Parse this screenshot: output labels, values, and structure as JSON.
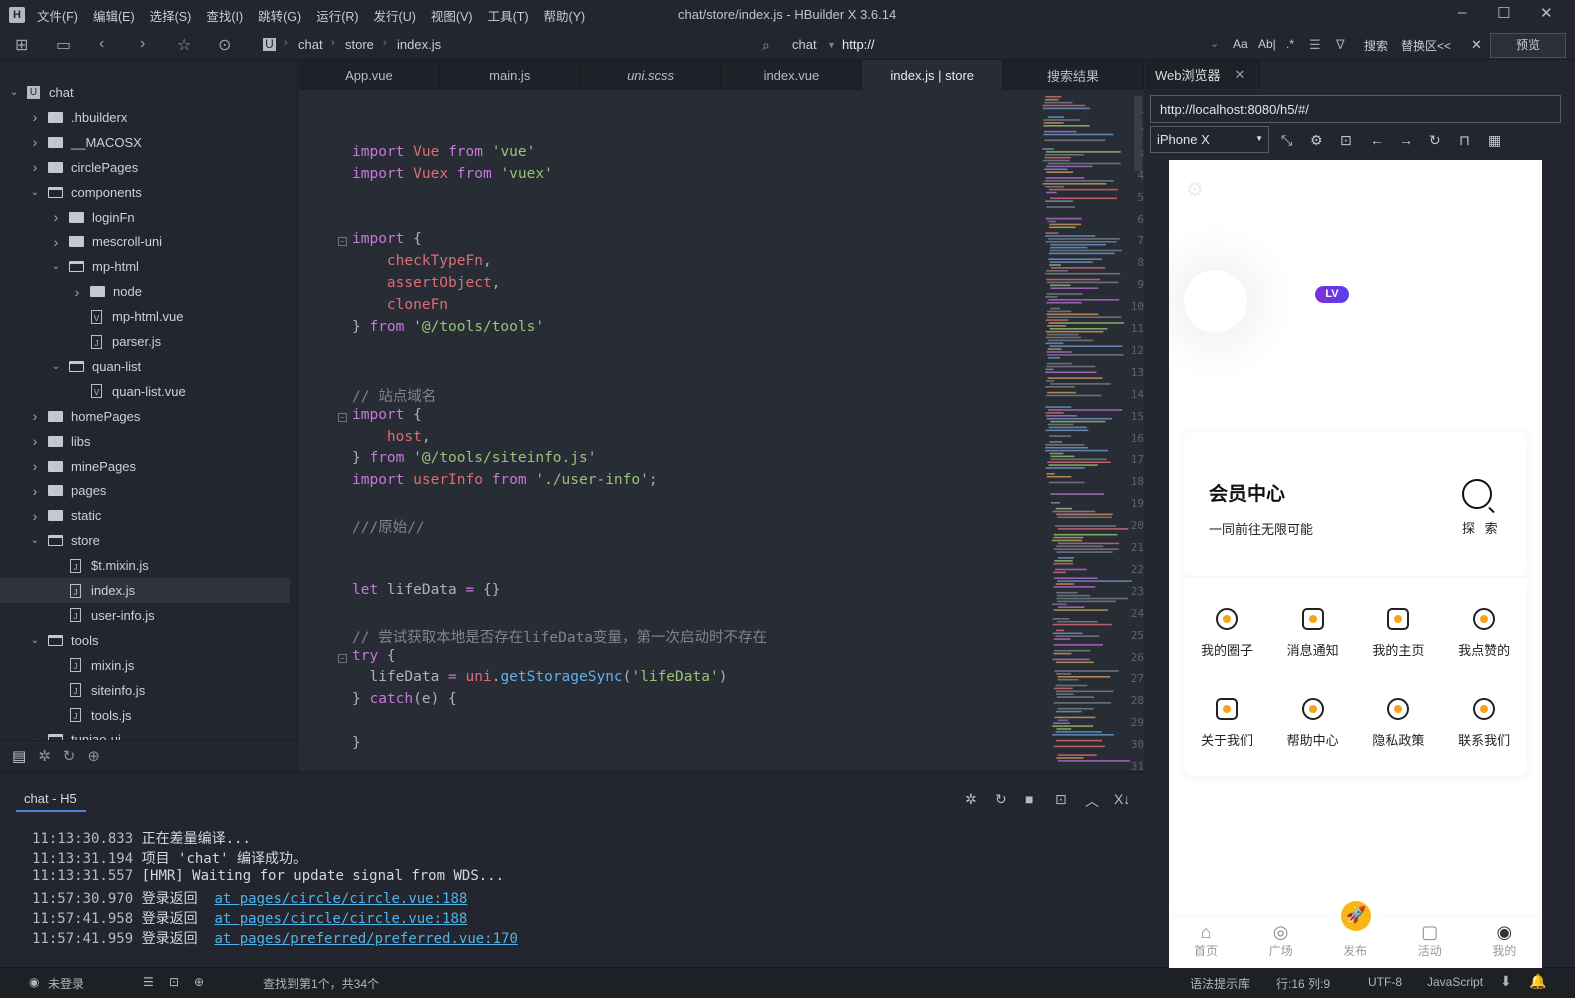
{
  "app": {
    "window_title": "chat/store/index.js - HBuilder X 3.6.14",
    "logo": "H",
    "menu": [
      "文件(F)",
      "编辑(E)",
      "选择(S)",
      "查找(I)",
      "跳转(G)",
      "运行(R)",
      "发行(U)",
      "视图(V)",
      "工具(T)",
      "帮助(Y)"
    ],
    "window_controls": {
      "minimize": "–",
      "maximize": "☐",
      "close": "✕"
    }
  },
  "toolbar": {
    "breadcrumb": [
      "chat",
      "store",
      "index.js"
    ],
    "project_select": "chat",
    "url_input": "http://",
    "search_label": "搜索",
    "replace_label": "替换区<<",
    "preview_label": "预览",
    "search_options": [
      "Aa",
      "Ab|",
      ".*"
    ]
  },
  "sidebar": {
    "tree": [
      {
        "label": "chat",
        "type": "project",
        "level": 0,
        "state": "open"
      },
      {
        "label": ".hbuilderx",
        "type": "folder",
        "level": 1,
        "state": "closed"
      },
      {
        "label": "__MACOSX",
        "type": "folder",
        "level": 1,
        "state": "closed"
      },
      {
        "label": "circlePages",
        "type": "folder",
        "level": 1,
        "state": "closed"
      },
      {
        "label": "components",
        "type": "folder",
        "level": 1,
        "state": "open"
      },
      {
        "label": "loginFn",
        "type": "folder",
        "level": 2,
        "state": "closed"
      },
      {
        "label": "mescroll-uni",
        "type": "folder",
        "level": 2,
        "state": "closed"
      },
      {
        "label": "mp-html",
        "type": "folder",
        "level": 2,
        "state": "open"
      },
      {
        "label": "node",
        "type": "folder",
        "level": 3,
        "state": "closed"
      },
      {
        "label": "mp-html.vue",
        "type": "vue",
        "level": 3
      },
      {
        "label": "parser.js",
        "type": "js",
        "level": 3
      },
      {
        "label": "quan-list",
        "type": "folder",
        "level": 2,
        "state": "open"
      },
      {
        "label": "quan-list.vue",
        "type": "vue",
        "level": 3
      },
      {
        "label": "homePages",
        "type": "folder",
        "level": 1,
        "state": "closed"
      },
      {
        "label": "libs",
        "type": "folder",
        "level": 1,
        "state": "closed"
      },
      {
        "label": "minePages",
        "type": "folder",
        "level": 1,
        "state": "closed"
      },
      {
        "label": "pages",
        "type": "folder",
        "level": 1,
        "state": "closed"
      },
      {
        "label": "static",
        "type": "folder",
        "level": 1,
        "state": "closed"
      },
      {
        "label": "store",
        "type": "folder",
        "level": 1,
        "state": "open"
      },
      {
        "label": "$t.mixin.js",
        "type": "js",
        "level": 2
      },
      {
        "label": "index.js",
        "type": "js",
        "level": 2,
        "selected": true
      },
      {
        "label": "user-info.js",
        "type": "js",
        "level": 2
      },
      {
        "label": "tools",
        "type": "folder",
        "level": 1,
        "state": "open"
      },
      {
        "label": "mixin.js",
        "type": "js",
        "level": 2
      },
      {
        "label": "siteinfo.js",
        "type": "js",
        "level": 2
      },
      {
        "label": "tools.js",
        "type": "js",
        "level": 2
      },
      {
        "label": "tuniao-ui",
        "type": "folder",
        "level": 1,
        "state": "open"
      }
    ]
  },
  "editor": {
    "tabs": [
      {
        "label": "App.vue"
      },
      {
        "label": "main.js"
      },
      {
        "label": "uni.scss",
        "italic": true
      },
      {
        "label": "index.vue"
      },
      {
        "label": "index.js | store",
        "active": true
      },
      {
        "label": "搜索结果"
      }
    ],
    "lines": [
      {
        "n": 1,
        "tokens": []
      },
      {
        "n": 2,
        "tokens": []
      },
      {
        "n": 3,
        "tokens": [
          [
            "k",
            "import"
          ],
          [
            "p",
            " "
          ],
          [
            "v",
            "Vue"
          ],
          [
            "p",
            " "
          ],
          [
            "k",
            "from"
          ],
          [
            "p",
            " "
          ],
          [
            "s",
            "'vue'"
          ]
        ]
      },
      {
        "n": 4,
        "tokens": [
          [
            "k",
            "import"
          ],
          [
            "p",
            " "
          ],
          [
            "v",
            "Vuex"
          ],
          [
            "p",
            " "
          ],
          [
            "k",
            "from"
          ],
          [
            "p",
            " "
          ],
          [
            "s",
            "'vuex'"
          ]
        ]
      },
      {
        "n": 5,
        "tokens": []
      },
      {
        "n": 6,
        "tokens": []
      },
      {
        "n": 7,
        "fold": true,
        "tokens": [
          [
            "k",
            "import"
          ],
          [
            "p",
            " {"
          ]
        ]
      },
      {
        "n": 8,
        "tokens": [
          [
            "p",
            "    "
          ],
          [
            "v",
            "checkTypeFn"
          ],
          [
            "p",
            ","
          ]
        ]
      },
      {
        "n": 9,
        "tokens": [
          [
            "p",
            "    "
          ],
          [
            "v",
            "assertObject"
          ],
          [
            "p",
            ","
          ]
        ]
      },
      {
        "n": 10,
        "tokens": [
          [
            "p",
            "    "
          ],
          [
            "v",
            "cloneFn"
          ]
        ]
      },
      {
        "n": 11,
        "tokens": [
          [
            "p",
            "} "
          ],
          [
            "k",
            "from"
          ],
          [
            "p",
            " "
          ],
          [
            "s",
            "'@/tools/tools'"
          ]
        ]
      },
      {
        "n": 12,
        "tokens": []
      },
      {
        "n": 13,
        "tokens": []
      },
      {
        "n": 14,
        "tokens": [
          [
            "c",
            "// 站点域名"
          ]
        ]
      },
      {
        "n": 15,
        "fold": true,
        "tokens": [
          [
            "k",
            "import"
          ],
          [
            "p",
            " {"
          ]
        ]
      },
      {
        "n": 16,
        "tokens": [
          [
            "p",
            "    "
          ],
          [
            "v",
            "host"
          ],
          [
            "p",
            ","
          ]
        ]
      },
      {
        "n": 17,
        "tokens": [
          [
            "p",
            "} "
          ],
          [
            "k",
            "from"
          ],
          [
            "p",
            " "
          ],
          [
            "s",
            "'@/tools/siteinfo.js'"
          ]
        ]
      },
      {
        "n": 18,
        "tokens": [
          [
            "k",
            "import"
          ],
          [
            "p",
            " "
          ],
          [
            "v",
            "userInfo"
          ],
          [
            "p",
            " "
          ],
          [
            "k",
            "from"
          ],
          [
            "p",
            " "
          ],
          [
            "s",
            "'./user-info'"
          ],
          [
            "p",
            ";"
          ]
        ]
      },
      {
        "n": 19,
        "tokens": []
      },
      {
        "n": 20,
        "tokens": [
          [
            "c",
            "///原始//"
          ]
        ]
      },
      {
        "n": 21,
        "tokens": []
      },
      {
        "n": 22,
        "tokens": []
      },
      {
        "n": 23,
        "tokens": [
          [
            "k",
            "let"
          ],
          [
            "p",
            " lifeData "
          ],
          [
            "k",
            "="
          ],
          [
            "p",
            " {}"
          ]
        ]
      },
      {
        "n": 24,
        "tokens": []
      },
      {
        "n": 25,
        "tokens": [
          [
            "c",
            "// 尝试获取本地是否存在lifeData变量，第一次启动时不存在"
          ]
        ]
      },
      {
        "n": 26,
        "fold": true,
        "tokens": [
          [
            "k",
            "try"
          ],
          [
            "p",
            " {"
          ]
        ]
      },
      {
        "n": 27,
        "tokens": [
          [
            "p",
            "  lifeData "
          ],
          [
            "k",
            "="
          ],
          [
            "p",
            " "
          ],
          [
            "v",
            "uni"
          ],
          [
            "p",
            "."
          ],
          [
            "f",
            "getStorageSync"
          ],
          [
            "p",
            "("
          ],
          [
            "s",
            "'lifeData'"
          ],
          [
            "p",
            ")"
          ]
        ]
      },
      {
        "n": 28,
        "tokens": [
          [
            "p",
            "} "
          ],
          [
            "k",
            "catch"
          ],
          [
            "p",
            "(e) {"
          ]
        ]
      },
      {
        "n": 29,
        "tokens": []
      },
      {
        "n": 30,
        "tokens": [
          [
            "p",
            "}"
          ]
        ]
      },
      {
        "n": 31,
        "tokens": []
      }
    ]
  },
  "console": {
    "tab_label": "chat - H5",
    "logs": [
      {
        "time": "11:13:30.833",
        "msg": "正在差量编译...",
        "link": ""
      },
      {
        "time": "11:13:31.194",
        "msg": "项目 'chat' 编译成功。",
        "link": ""
      },
      {
        "time": "11:13:31.557",
        "msg": "[HMR] Waiting for update signal from WDS...",
        "link": ""
      },
      {
        "time": "11:57:30.970",
        "msg": "登录返回  ",
        "link": "at pages/circle/circle.vue:188"
      },
      {
        "time": "11:57:41.958",
        "msg": "登录返回  ",
        "link": "at pages/circle/circle.vue:188"
      },
      {
        "time": "11:57:41.959",
        "msg": "登录返回  ",
        "link": "at pages/preferred/preferred.vue:170"
      }
    ]
  },
  "statusbar": {
    "user": "未登录",
    "find_result": "查找到第1个，共34个",
    "syntax_lib": "语法提示库",
    "position": "行:16  列:9",
    "encoding": "UTF-8",
    "language": "JavaScript"
  },
  "browser": {
    "tab_label": "Web浏览器",
    "url": "http://localhost:8080/h5/#/",
    "device": "iPhone X",
    "page": {
      "lv_badge": "LV",
      "vip_title": "会员中心",
      "vip_subtitle": "一同前往无限可能",
      "explore_label": "探 索",
      "grid": [
        "我的圈子",
        "消息通知",
        "我的主页",
        "我点赞的",
        "关于我们",
        "帮助中心",
        "隐私政策",
        "联系我们"
      ],
      "tabbar": [
        "首页",
        "广场",
        "发布",
        "活动",
        "我的"
      ],
      "accent_color": "#f7a41b",
      "lv_color": "#6a37e3"
    }
  }
}
